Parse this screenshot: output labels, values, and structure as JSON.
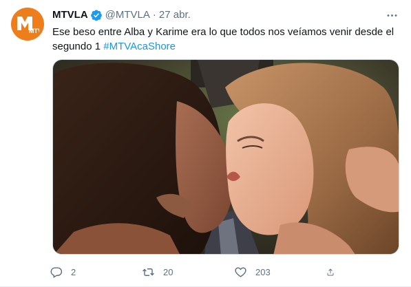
{
  "colors": {
    "accent": "#1b95e0",
    "text": "#0f1419",
    "muted": "#5b7083",
    "avatar_bg": "#ee7d1c"
  },
  "author": {
    "name": "MTVLA",
    "handle": "@MTVLA",
    "separator": "·",
    "date": "27 abr.",
    "avatar_icon": "mtv-logo-icon",
    "verified_icon": "verified-badge-icon",
    "avatar_logo_text": "MTV"
  },
  "tweet": {
    "text": "Ese beso entre Alba y Karime era lo que todos nos veíamos venir desde el segundo 1 ",
    "hashtag": "#MTVAcaShore"
  },
  "media": {
    "type": "photo",
    "description_icon": "photo-two-women-kissing"
  },
  "actions": {
    "reply_count": "2",
    "retweet_count": "20",
    "like_count": "203",
    "reply_icon": "reply-icon",
    "retweet_icon": "retweet-icon",
    "like_icon": "heart-icon",
    "share_icon": "share-icon"
  },
  "menu": {
    "more_icon": "more-icon"
  }
}
